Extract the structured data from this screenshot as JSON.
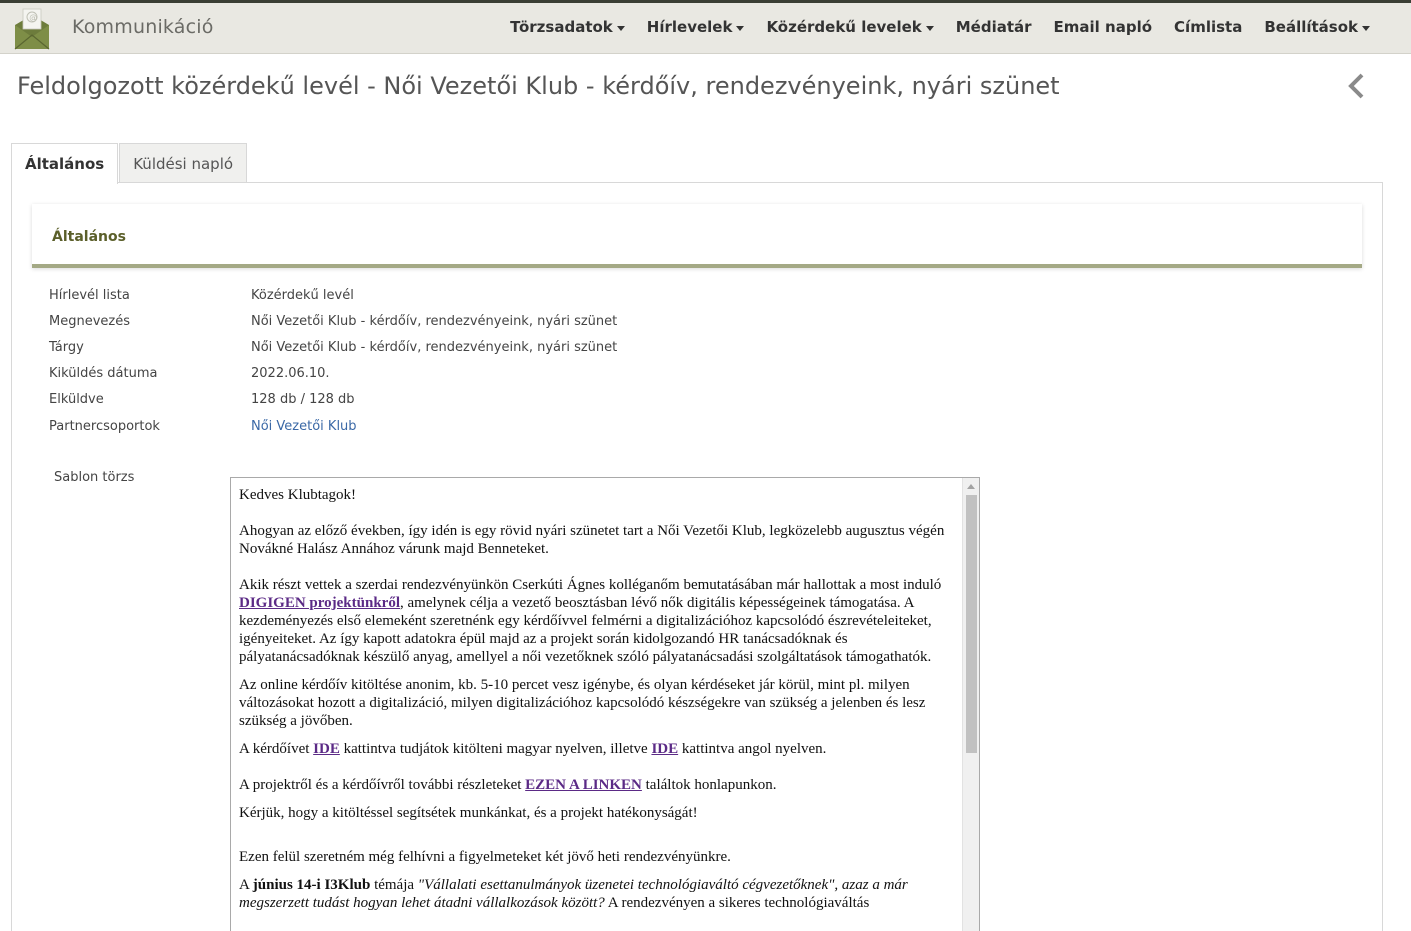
{
  "app": {
    "title": "Kommunikáció"
  },
  "nav": {
    "items": [
      {
        "label": "Törzsadatok",
        "dropdown": true
      },
      {
        "label": "Hírlevelek",
        "dropdown": true
      },
      {
        "label": "Közérdekű levelek",
        "dropdown": true
      },
      {
        "label": "Médiatár",
        "dropdown": false
      },
      {
        "label": "Email napló",
        "dropdown": false
      },
      {
        "label": "Címlista",
        "dropdown": false
      },
      {
        "label": "Beállítások",
        "dropdown": true
      }
    ]
  },
  "page": {
    "title": "Feldolgozott közérdekű levél - Női Vezetői Klub - kérdőív, rendezvényeink, nyári szünet"
  },
  "tabs": [
    {
      "label": "Általános",
      "active": true
    },
    {
      "label": "Küldési napló",
      "active": false
    }
  ],
  "section": {
    "title": "Általános"
  },
  "fields": [
    {
      "label": "Hírlevél lista",
      "value": "Közérdekű levél",
      "link": false
    },
    {
      "label": "Megnevezés",
      "value": "Női Vezetői Klub - kérdőív, rendezvényeink, nyári szünet",
      "link": false
    },
    {
      "label": "Tárgy",
      "value": "Női Vezetői Klub - kérdőív, rendezvényeink, nyári szünet",
      "link": false
    },
    {
      "label": "Kiküldés dátuma",
      "value": "2022.06.10.",
      "link": false
    },
    {
      "label": "Elküldve",
      "value": "128 db / 128 db",
      "link": false
    },
    {
      "label": "Partnercsoportok",
      "value": "Női Vezetői Klub",
      "link": true
    }
  ],
  "template": {
    "label": "Sablon törzs",
    "greeting": "Kedves Klubtagok!",
    "p1": "Ahogyan az előző években, így idén is egy rövid nyári szünetet tart a Női Vezetői Klub, legközelebb augusztus végén Novákné Halász Annához várunk majd Benneteket.",
    "p2_before": "Akik részt vettek a szerdai rendezvényünkön Cserkúti Ágnes kolléganőm bemutatásában már hallottak a most induló ",
    "p2_link": "DIGIGEN projektünkről",
    "p2_after": ", amelynek célja a vezető beosztásban lévő nők digitális képességeinek támogatása. A kezdeményezés első elemeként szeretnénk egy kérdőívvel felmérni a digitalizációhoz kapcsolódó észrevételeiteket, igényeiteket. Az így kapott adatokra épül majd az a projekt során kidolgozandó HR tanácsadóknak és pályatanácsadóknak készülő anyag, amellyel a női vezetőknek szóló pályatanácsadási szolgáltatások támogathatók.",
    "p3": "Az online kérdőív kitöltése anonim, kb. 5-10 percet vesz igénybe, és olyan kérdéseket jár körül, mint pl. milyen változásokat hozott a digitalizáció, milyen digitalizációhoz kapcsolódó készségekre van szükség a jelenben és lesz szükség a jövőben.",
    "p4_before": "A kérdőívet ",
    "p4_link1": "IDE",
    "p4_middle": " kattintva tudjátok kitölteni magyar nyelven, illetve ",
    "p4_link2": "IDE",
    "p4_after": " kattintva angol nyelven.",
    "p5_before": "A projektről és a kérdőívről további részleteket ",
    "p5_link": "EZEN A LINKEN",
    "p5_after": " találtok honlapunkon.",
    "p6": "Kérjük, hogy a kitöltéssel segítsétek munkánkat, és a projekt hatékonyságát!",
    "p7": "Ezen felül szeretném még felhívni a figyelmeteket két jövő heti rendezvényünkre.",
    "p8_before": "A ",
    "p8_bold": "június 14-i I3Klub",
    "p8_middle": " témája ",
    "p8_italic": "\"Vállalati esettanulmányok üzenetei technológiaváltó cégvezetőknek\", azaz a már megszerzett tudást hogyan lehet átadni vállalkozások között?",
    "p8_after": " A rendezvényen a sikeres technológiaváltás"
  },
  "colors": {
    "topbar_bg": "#e9e8e2",
    "section_accent": "#a4a985",
    "section_title": "#5b5f2a",
    "link": "#3a68a6",
    "template_link": "#5b2a86"
  }
}
